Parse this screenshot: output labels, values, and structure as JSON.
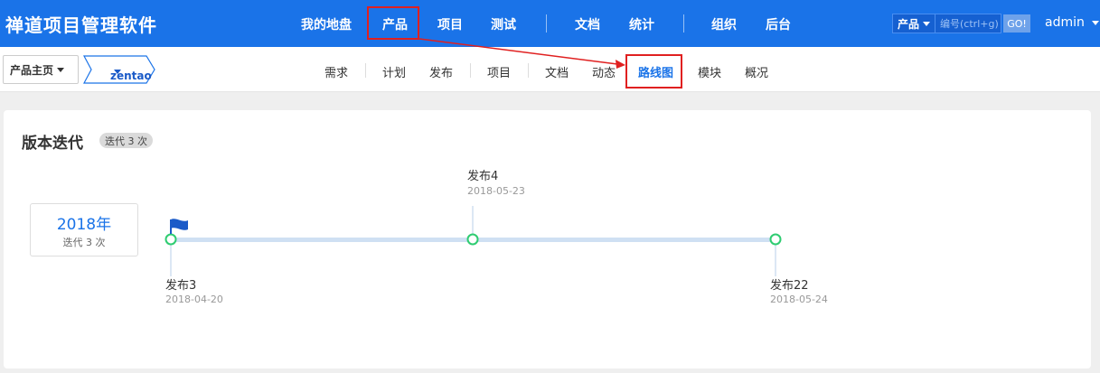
{
  "header": {
    "brand": "禅道项目管理软件",
    "nav": [
      {
        "label": "我的地盘",
        "active": false
      },
      {
        "label": "产品",
        "active": true
      },
      {
        "label": "项目",
        "active": false
      },
      {
        "label": "测试",
        "active": false
      },
      {
        "label": "文档",
        "active": false
      },
      {
        "label": "统计",
        "active": false
      },
      {
        "label": "组织",
        "active": false
      },
      {
        "label": "后台",
        "active": false
      }
    ],
    "search": {
      "type_label": "产品",
      "placeholder": "编号(ctrl+g)",
      "go_label": "GO!"
    },
    "user": "admin"
  },
  "subheader": {
    "breadcrumb_home": "产品主页",
    "breadcrumb_product": "zentao",
    "nav": [
      {
        "label": "需求",
        "active": false
      },
      {
        "label": "计划",
        "active": false
      },
      {
        "label": "发布",
        "active": false
      },
      {
        "label": "项目",
        "active": false
      },
      {
        "label": "文档",
        "active": false
      },
      {
        "label": "动态",
        "active": false
      },
      {
        "label": "路线图",
        "active": true
      },
      {
        "label": "模块",
        "active": false
      },
      {
        "label": "概况",
        "active": false
      }
    ]
  },
  "roadmap": {
    "title": "版本迭代",
    "count_badge": "迭代 3 次",
    "year": {
      "label": "2018年",
      "sub": "迭代 3 次"
    },
    "releases": [
      {
        "name": "发布3",
        "date": "2018-04-20",
        "position": "below",
        "current": true
      },
      {
        "name": "发布4",
        "date": "2018-05-23",
        "position": "above",
        "current": false
      },
      {
        "name": "发布22",
        "date": "2018-05-24",
        "position": "below",
        "current": false
      }
    ]
  },
  "colors": {
    "header_bg": "#1a73e8",
    "accent": "#1a73e8",
    "highlight": "#e02020",
    "milestone": "#2ecc71",
    "track": "#cfe0f3"
  }
}
